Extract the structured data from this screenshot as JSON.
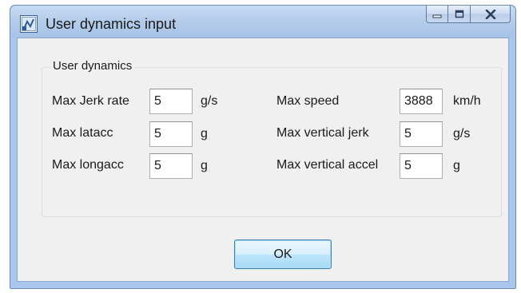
{
  "window": {
    "title": "User dynamics input",
    "icon": "app-icon",
    "controls": {
      "minimize": "minimize-icon",
      "maximize": "maximize-icon",
      "close": "close-icon"
    }
  },
  "group": {
    "label": "User dynamics",
    "fields": {
      "max_jerk_rate": {
        "label": "Max Jerk rate",
        "value": "5",
        "unit": "g/s"
      },
      "max_latacc": {
        "label": "Max latacc",
        "value": "5",
        "unit": "g"
      },
      "max_longacc": {
        "label": "Max longacc",
        "value": "5",
        "unit": "g"
      },
      "max_speed": {
        "label": "Max speed",
        "value": "3888",
        "unit": "km/h"
      },
      "max_vertical_jerk": {
        "label": "Max vertical jerk",
        "value": "5",
        "unit": "g/s"
      },
      "max_vertical_accel": {
        "label": "Max vertical accel",
        "value": "5",
        "unit": "g"
      }
    }
  },
  "buttons": {
    "ok_label": "OK"
  },
  "colors": {
    "titlebar": "#b5cdeb",
    "client_background": "#f0f0f0",
    "ok_button": "#bee6fd",
    "field_border": "#abadb3"
  }
}
